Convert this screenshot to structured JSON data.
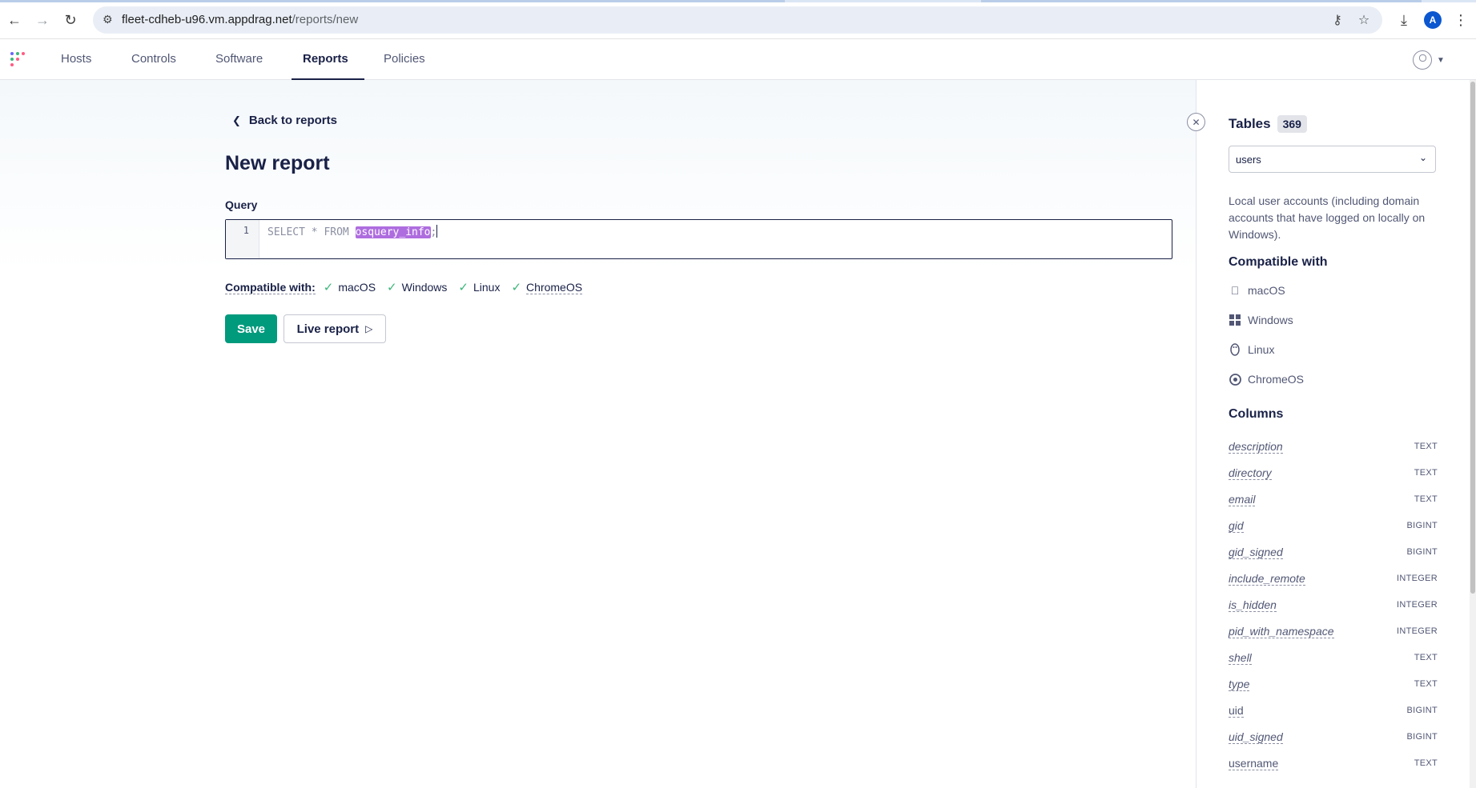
{
  "browser": {
    "url_host": "fleet-cdheb-u96.vm.appdrag.net",
    "url_path": "/reports/new",
    "profile_initial": "A"
  },
  "nav": {
    "items": [
      {
        "label": "Hosts"
      },
      {
        "label": "Controls"
      },
      {
        "label": "Software"
      },
      {
        "label": "Reports"
      },
      {
        "label": "Policies"
      }
    ],
    "active": "Reports"
  },
  "main": {
    "back_label": "Back to reports",
    "title": "New report",
    "query_label": "Query",
    "editor": {
      "line_number": "1",
      "code_prefix": "SELECT * FROM ",
      "code_selected": "osquery_info",
      "code_suffix": ";"
    },
    "compatible": {
      "title": "Compatible with:",
      "platforms": [
        "macOS",
        "Windows",
        "Linux",
        "ChromeOS"
      ]
    },
    "save_label": "Save",
    "live_label": "Live report"
  },
  "sidebar": {
    "title": "Tables",
    "count": "369",
    "selected_table": "users",
    "description": "Local user accounts (including domain accounts that have logged on locally on Windows).",
    "compatible_title": "Compatible with",
    "platforms": [
      {
        "label": "macOS",
        "icon": "apple-icon"
      },
      {
        "label": "Windows",
        "icon": "windows-icon"
      },
      {
        "label": "Linux",
        "icon": "linux-icon"
      },
      {
        "label": "ChromeOS",
        "icon": "chrome-icon"
      }
    ],
    "columns_title": "Columns",
    "columns": [
      {
        "name": "description",
        "type": "TEXT"
      },
      {
        "name": "directory",
        "type": "TEXT"
      },
      {
        "name": "email",
        "type": "TEXT"
      },
      {
        "name": "gid",
        "type": "BIGINT"
      },
      {
        "name": "gid_signed",
        "type": "BIGINT"
      },
      {
        "name": "include_remote",
        "type": "INTEGER"
      },
      {
        "name": "is_hidden",
        "type": "INTEGER"
      },
      {
        "name": "pid_with_namespace",
        "type": "INTEGER"
      },
      {
        "name": "shell",
        "type": "TEXT"
      },
      {
        "name": "type",
        "type": "TEXT"
      },
      {
        "name": "uid",
        "type": "BIGINT"
      },
      {
        "name": "uid_signed",
        "type": "BIGINT"
      },
      {
        "name": "username",
        "type": "TEXT"
      }
    ]
  },
  "colors": {
    "primary": "#009a7d",
    "text": "#192147",
    "selection": "#ae6ddf",
    "check": "#3db67b"
  }
}
